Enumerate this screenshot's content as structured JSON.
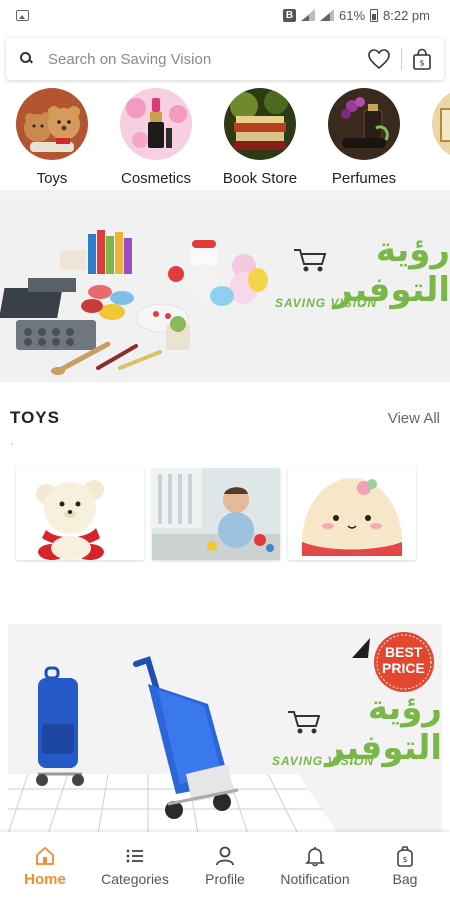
{
  "status_bar": {
    "battery": "61%",
    "time": "8:22 pm",
    "icons": [
      "gallery-icon",
      "b-icon",
      "signal-icon",
      "battery-icon"
    ]
  },
  "search": {
    "placeholder": "Search on Saving Vision",
    "icons": [
      "search-icon",
      "heart-icon",
      "bag-icon"
    ]
  },
  "categories": [
    {
      "label": "Toys"
    },
    {
      "label": "Cosmetics"
    },
    {
      "label": "Book Store"
    },
    {
      "label": "Perfumes"
    }
  ],
  "banner": {
    "brand_arabic": "رؤية التوفير",
    "brand_english": "SAVING VISION"
  },
  "toys_section": {
    "title": "TOYS",
    "view_all": "View All",
    "dot": "."
  },
  "banner2": {
    "badge_line1": "BEST",
    "badge_line2": "PRICE",
    "brand_arabic": "رؤية التوفير",
    "brand_english": "SAVING VISION"
  },
  "bottom_nav": {
    "items": [
      {
        "label": "Home",
        "icon": "home-icon",
        "active": true
      },
      {
        "label": "Categories",
        "icon": "list-icon",
        "active": false
      },
      {
        "label": "Profile",
        "icon": "person-icon",
        "active": false
      },
      {
        "label": "Notification",
        "icon": "bell-icon",
        "active": false
      },
      {
        "label": "Bag",
        "icon": "bag-icon",
        "active": false
      }
    ]
  },
  "colors": {
    "accent": "#f58a2e",
    "brand_green": "#7ab648",
    "banner_bg": "#f1f1f1"
  }
}
